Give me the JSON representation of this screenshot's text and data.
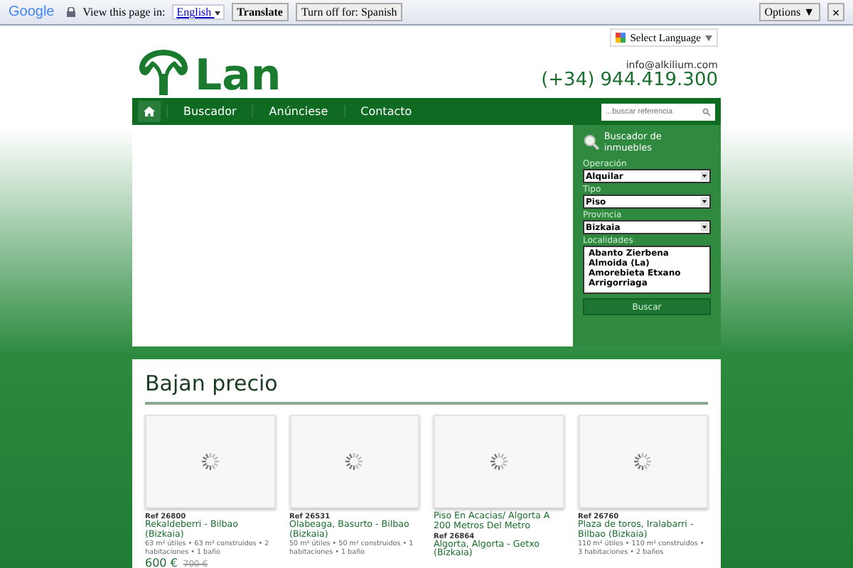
{
  "translate_bar": {
    "brand": "Google",
    "label": "View this page in:",
    "language": "English",
    "buttons": [
      "Translate",
      "Turn off for: Spanish"
    ],
    "options": "Options ▼",
    "close": "×"
  },
  "header": {
    "logo": "Lan",
    "language_selector": "Select Language",
    "email": "info@alkilium.com",
    "phone": "(+34) 944.419.300"
  },
  "nav": {
    "items": [
      {
        "kind": "home"
      },
      {
        "kind": "link",
        "label": "Buscador"
      },
      {
        "kind": "link",
        "label": "Anúnciese"
      },
      {
        "kind": "link",
        "label": "Contacto"
      }
    ],
    "search": {
      "placeholder": "...buscar referencia"
    }
  },
  "search_panel": {
    "title": "Buscador de inmuebles",
    "fields": [
      {
        "label": "Operación",
        "value": "Alquilar"
      },
      {
        "label": "Tipo",
        "value": "Piso"
      },
      {
        "label": "Provincia",
        "value": "Bizkaia"
      }
    ],
    "localidades": {
      "label": "Localidades",
      "options": [
        "Abanto Zierbena",
        "Almoida (La)",
        "Amorebieta Etxano",
        "Arrigorriaga"
      ]
    },
    "button": "Buscar"
  },
  "section": {
    "title": "Bajan precio",
    "cards": [
      {
        "ref": "Ref 26800",
        "location": "Rekaldeberri - Bilbao (Bizkaia)",
        "details": "63 m² útiles • 63 m² construidos • 2 habitaciones • 1 baño",
        "price": "600 €",
        "old_price": "700 €"
      },
      {
        "ref": "Ref 26531",
        "location": "Olabeaga, Basurto - Bilbao (Bizkaia)",
        "details": "50 m² útiles • 50 m² construidos • 1 habitaciones • 1 baño"
      },
      {
        "heading": "Piso En Acacias/ Algorta A 200 Metros Del Metro",
        "ref": "Ref 26864",
        "location": "Algorta, Algorta - Getxo (Bizkaia)"
      },
      {
        "ref": "Ref 26760",
        "location": "Plaza de toros, Iralabarri - Bilbao (Bizkaia)",
        "details": "110 m² útiles • 110 m² construidos • 3 habitaciones • 2 baños"
      }
    ]
  }
}
